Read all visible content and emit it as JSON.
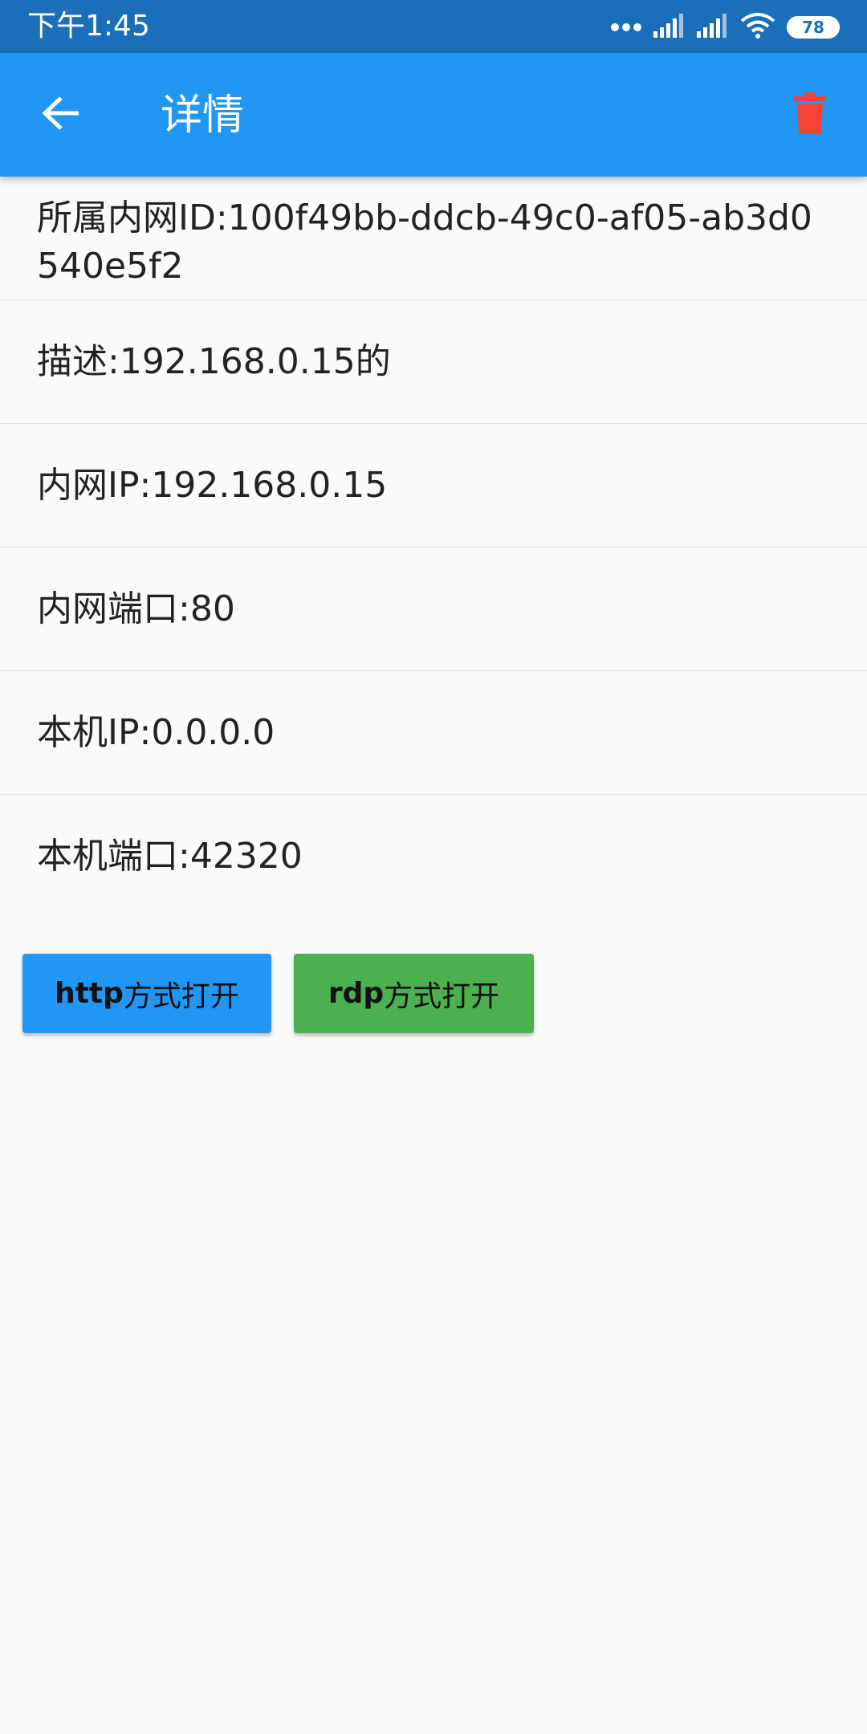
{
  "status_bar": {
    "time": "下午1:45",
    "battery": "78",
    "icons": [
      "more-dots-icon",
      "signal-icon",
      "signal-icon",
      "wifi-icon",
      "battery-icon"
    ]
  },
  "app_bar": {
    "title": "详情",
    "back_icon": "back-arrow-icon",
    "delete_icon": "trash-icon",
    "delete_color": "#f44336",
    "background": "#2196f3"
  },
  "details": {
    "intranet_id": "所属内网ID:100f49bb-ddcb-49c0-af05-ab3d0540e5f2",
    "description": "描述:192.168.0.15的",
    "intranet_ip": "内网IP:192.168.0.15",
    "intranet_port": "内网端口:80",
    "local_ip": "本机IP:0.0.0.0",
    "local_port": "本机端口:42320"
  },
  "actions": {
    "http": {
      "prefix": "http",
      "suffix": "方式打开",
      "color": "#2196f3"
    },
    "rdp": {
      "prefix": "rdp",
      "suffix": "方式打开",
      "color": "#4caf50"
    }
  }
}
